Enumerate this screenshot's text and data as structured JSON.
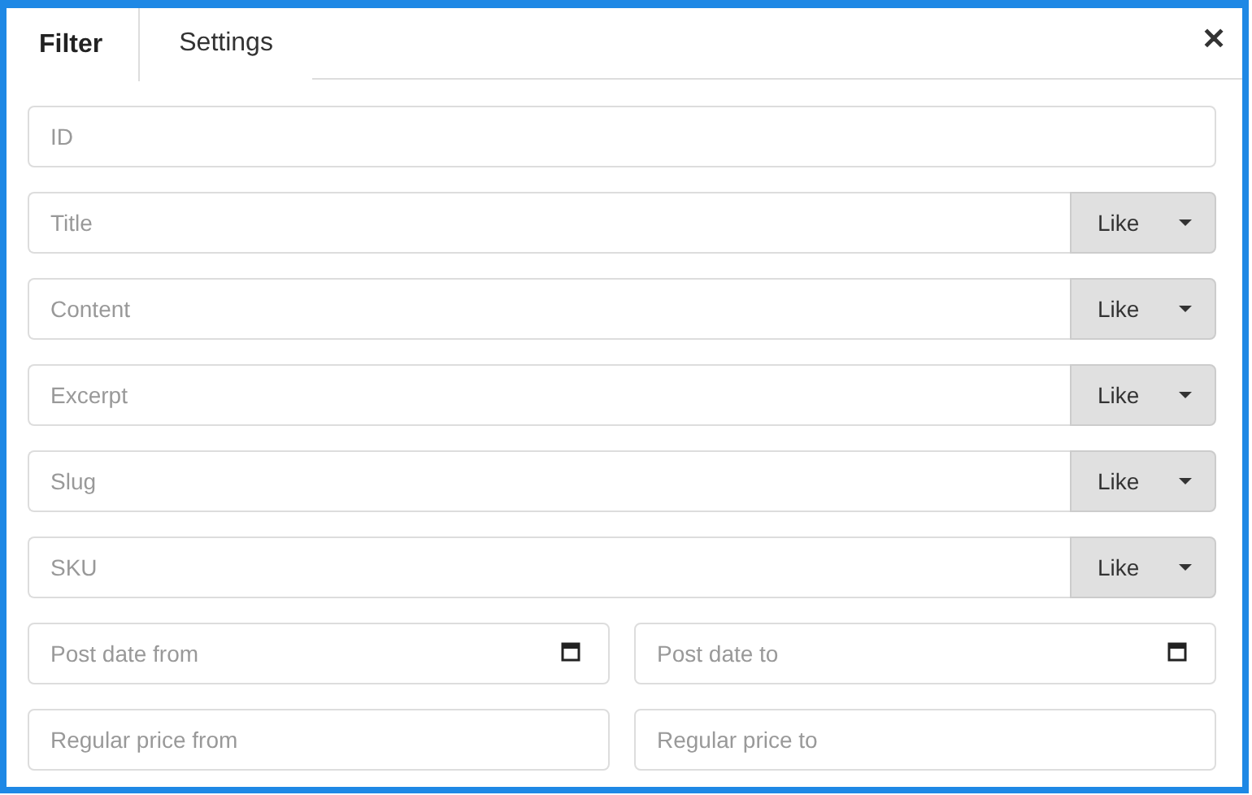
{
  "tabs": [
    {
      "label": "Filter",
      "selected": true
    },
    {
      "label": "Settings",
      "selected": false
    }
  ],
  "close": "✕",
  "rows": [
    {
      "kind": "text",
      "placeholder": "ID"
    },
    {
      "kind": "operator",
      "placeholder": "Title",
      "operator": "Like"
    },
    {
      "kind": "operator",
      "placeholder": "Content",
      "operator": "Like"
    },
    {
      "kind": "operator",
      "placeholder": "Excerpt",
      "operator": "Like"
    },
    {
      "kind": "operator",
      "placeholder": "Slug",
      "operator": "Like"
    },
    {
      "kind": "operator",
      "placeholder": "SKU",
      "operator": "Like"
    },
    {
      "kind": "date-range",
      "from": {
        "placeholder": "Post date from"
      },
      "to": {
        "placeholder": "Post date to"
      }
    },
    {
      "kind": "range",
      "from": {
        "placeholder": "Regular price from"
      },
      "to": {
        "placeholder": "Regular price to"
      }
    }
  ]
}
